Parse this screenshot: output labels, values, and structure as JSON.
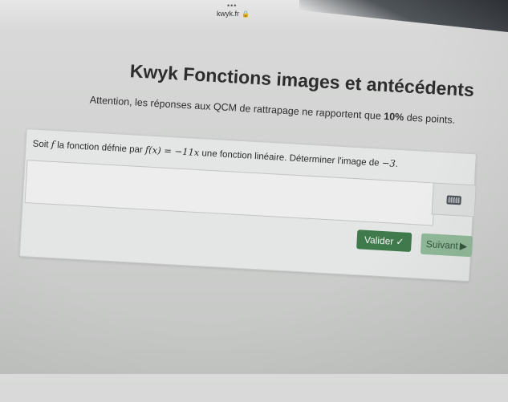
{
  "browser": {
    "url": "kwyk.fr",
    "tab_dots": "•••"
  },
  "page": {
    "title": "Kwyk Fonctions images et antécédents",
    "notice_prefix": "Attention, les réponses aux QCM de rattrapage ne rapportent que ",
    "notice_bold": "10%",
    "notice_suffix": " des points."
  },
  "question": {
    "text_1": "Soit ",
    "var_f": "f",
    "text_2": " la fonction défnie par ",
    "formula": "f(x) = −11x",
    "text_3": " une fonction linéaire. Déterminer l'image de ",
    "value": "−3",
    "text_4": "."
  },
  "answer": {
    "value": ""
  },
  "buttons": {
    "valider_label": "Valider",
    "valider_mark": "✓",
    "suivant_label": "Suivant",
    "suivant_mark": "▶"
  },
  "colors": {
    "valider_bg": "#3f7a4c",
    "suivant_bg": "#8fb898"
  }
}
